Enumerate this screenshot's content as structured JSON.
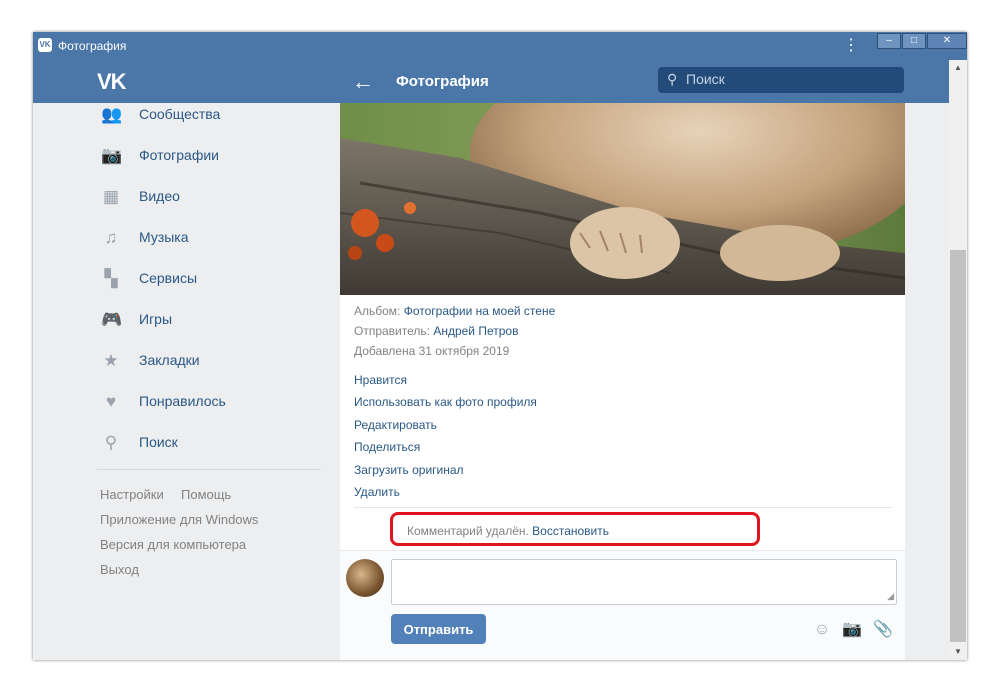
{
  "window": {
    "title": "Фотография",
    "logo_text": "VK",
    "menu_glyph": "⋮",
    "controls": {
      "minimize": "–",
      "maximize": "□",
      "close": "✕"
    }
  },
  "header": {
    "logo": "VK",
    "back_glyph": "←",
    "title": "Фотография",
    "search_icon": "⚲",
    "search_placeholder": "Поиск"
  },
  "sidebar": {
    "items": [
      {
        "label": "Сообщества",
        "icon": "👥"
      },
      {
        "label": "Фотографии",
        "icon": "📷"
      },
      {
        "label": "Видео",
        "icon": "▦"
      },
      {
        "label": "Музыка",
        "icon": "♫"
      },
      {
        "label": "Сервисы",
        "icon": "▚"
      },
      {
        "label": "Игры",
        "icon": "🎮"
      },
      {
        "label": "Закладки",
        "icon": "★"
      },
      {
        "label": "Понравилось",
        "icon": "♥"
      },
      {
        "label": "Поиск",
        "icon": "⚲"
      }
    ],
    "footer": {
      "settings": "Настройки",
      "help": "Помощь",
      "windows_app": "Приложение для Windows",
      "desktop_version": "Версия для компьютера",
      "logout": "Выход"
    }
  },
  "photo_info": {
    "album_label": "Альбом:",
    "album_value": "Фотографии на моей стене",
    "sender_label": "Отправитель:",
    "sender_value": "Андрей Петров",
    "added": "Добавлена 31 октября 2019"
  },
  "actions": [
    "Нравится",
    "Использовать как фото профиля",
    "Редактировать",
    "Поделиться",
    "Загрузить оригинал",
    "Удалить"
  ],
  "comment": {
    "deleted_text": "Комментарий удалён.",
    "restore_link": "Восстановить"
  },
  "composer": {
    "value": "",
    "send_label": "Отправить",
    "resize_glyph": "◢",
    "tools": {
      "emoji": "☺",
      "photo": "📷",
      "attach": "📎"
    }
  },
  "colors": {
    "header": "#4a76a8",
    "link": "#2a5885",
    "highlight": "#e0151f",
    "button": "#5181b8"
  }
}
